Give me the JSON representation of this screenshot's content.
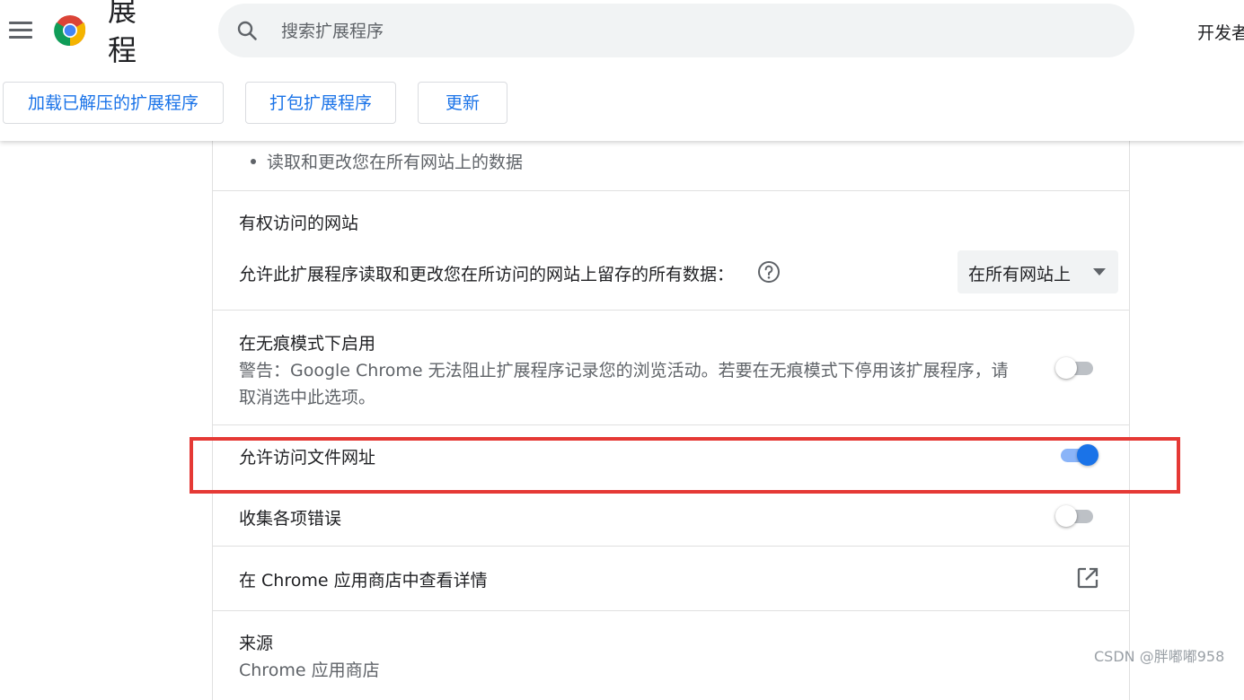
{
  "header": {
    "title_line1": "展",
    "title_line2": "程",
    "search_placeholder": "搜索扩展程序",
    "dev_mode_label": "开发者",
    "icons": {
      "menu": "hamburger-menu-icon",
      "logo": "chrome-logo",
      "search": "search-icon"
    }
  },
  "toolbar": {
    "load_unpacked": "加载已解压的扩展程序",
    "pack": "打包扩展程序",
    "update": "更新"
  },
  "details": {
    "permission_bullet": "读取和更改您在所有网站上的数据",
    "site_access": {
      "title": "有权访问的网站",
      "description": "允许此扩展程序读取和更改您在所访问的网站上留存的所有数据：",
      "dropdown_value": "在所有网站上"
    },
    "incognito": {
      "title": "在无痕模式下启用",
      "warning_line1": "警告：Google Chrome 无法阻止扩展程序记录您的浏览活动。若要在无痕模式下停用该扩展程序，请",
      "warning_line2": "取消选中此选项。",
      "enabled": false
    },
    "file_urls": {
      "title": "允许访问文件网址",
      "enabled": true
    },
    "collect_errors": {
      "title": "收集各项错误",
      "enabled": false
    },
    "store_link": {
      "title": "在 Chrome 应用商店中查看详情"
    },
    "source": {
      "title": "来源",
      "value": "Chrome 应用商店"
    }
  },
  "watermark": "CSDN @胖嘟嘟958",
  "colors": {
    "accent": "#1a73e8",
    "highlight": "#e53935",
    "toggle_on_track": "#8ab4f8",
    "toggle_off_track": "#bdc1c6"
  }
}
